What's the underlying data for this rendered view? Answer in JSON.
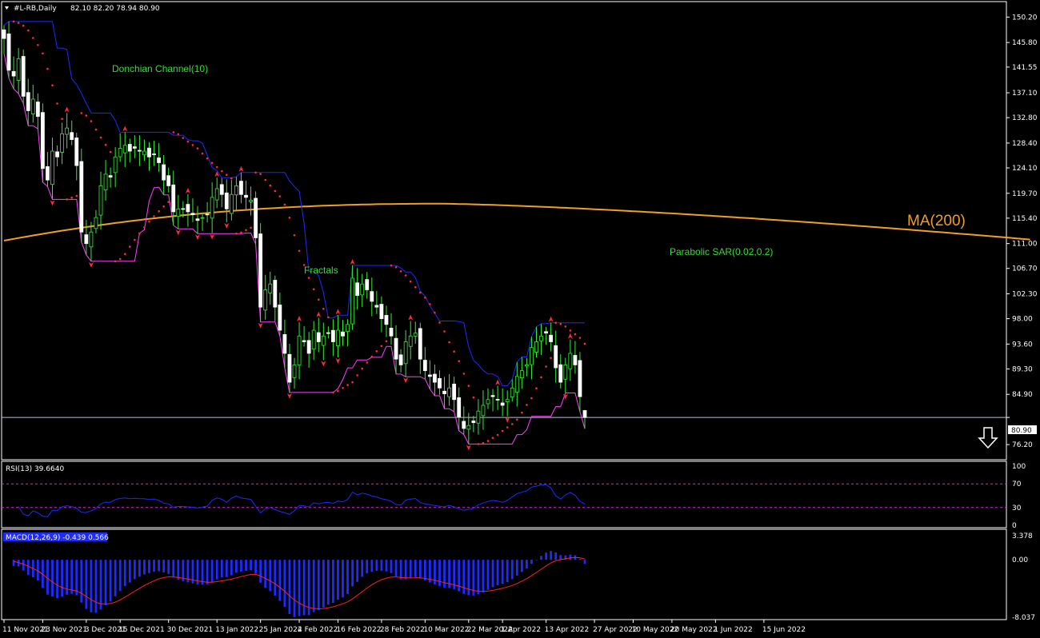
{
  "chart_data": [
    {
      "type": "candlestick",
      "title": "#L-RB,Daily",
      "ohlc_label": "82.10 82.20 78.94 80.90",
      "ylim": [
        74.0,
        151.5
      ],
      "y_ticks": [
        "150.20",
        "145.80",
        "141.55",
        "137.10",
        "132.80",
        "128.40",
        "124.10",
        "119.70",
        "115.40",
        "111.00",
        "106.70",
        "102.30",
        "98.00",
        "93.60",
        "89.30",
        "84.90",
        "80.90",
        "76.20"
      ],
      "x_labels": [
        "11 Nov 2021",
        "23 Nov 2021",
        "3 Dec 2021",
        "15 Dec 2021",
        "30 Dec 2021",
        "13 Jan 2022",
        "25 Jan 2022",
        "4 Feb 2022",
        "16 Feb 2022",
        "28 Feb 2022",
        "10 Mar 2022",
        "22 Mar 2022",
        "1 Apr 2022",
        "13 Apr 2022",
        "27 Apr 2022",
        "10 May 2022",
        "20 May 2022",
        "1 Jun 2022",
        "15 Jun 2022"
      ],
      "x_label_index": [
        0,
        8,
        17,
        24,
        34,
        44,
        53,
        61,
        69,
        78,
        87,
        96,
        103,
        112,
        122,
        130,
        138,
        147,
        157
      ],
      "current_price": 80.9,
      "close": [
        146.5,
        141,
        140,
        143,
        136.5,
        134,
        136,
        133,
        124,
        122,
        127,
        126,
        130,
        131,
        129,
        124.5,
        113,
        111,
        113,
        115.5,
        121,
        123,
        122.5,
        126,
        127.5,
        128,
        127,
        127.5,
        127,
        127,
        126,
        126.5,
        125,
        122,
        121,
        116.5,
        117,
        117,
        116.5,
        116,
        115,
        115.5,
        116,
        119,
        120.5,
        119.5,
        117,
        119.5,
        121,
        119.5,
        119,
        118.5,
        112,
        100,
        103,
        104,
        100,
        96,
        92,
        87,
        90,
        95,
        94,
        92,
        96,
        94,
        95,
        95.5,
        94,
        96,
        95,
        97,
        105,
        102,
        104,
        103,
        101,
        100,
        98,
        97,
        95,
        91,
        90,
        94,
        95,
        95.5,
        91,
        89,
        88,
        87,
        86,
        85,
        86,
        84,
        81,
        79,
        79.5,
        80,
        82,
        83,
        84,
        84.5,
        84,
        83,
        84,
        86,
        88,
        89,
        90,
        93,
        94,
        95,
        95.5,
        94,
        89.5,
        87,
        90,
        92,
        90,
        84.5,
        80.9
      ],
      "series": [
        {
          "name": "MA(200)",
          "color": "#f0a020",
          "start": [
            0,
            111.5
          ],
          "end": [
            212,
            111.7
          ],
          "peak": [
            90,
            117.9
          ]
        },
        {
          "name": "Donchian Channel(10)",
          "color": "#1e2aff"
        },
        {
          "name": "Donchian Channel(10)",
          "color": "#ff40ff"
        },
        {
          "name": "Parabolic SAR(0.02,0.2)",
          "color": "#ff2a3a"
        },
        {
          "name": "Fractals",
          "color": "#ff2a3a"
        }
      ],
      "annotations": [
        "Donchian Channel(10)",
        "Fractals",
        "Parabolic SAR(0.02,0.2)",
        "MA(200)"
      ],
      "arrow": "down",
      "grid": false
    },
    {
      "type": "line",
      "title": "RSI(13) 39.6640",
      "ylim": [
        0,
        100
      ],
      "y_ticks": [
        "100",
        "70",
        "30",
        "0"
      ],
      "levels": [
        70,
        30
      ],
      "color": "#1e2aff"
    },
    {
      "type": "bar",
      "title": "MACD(12,26,9) -0.439 0.566",
      "ylim": [
        -8.037,
        3.378
      ],
      "y_ticks": [
        "3.378",
        "0.00",
        "-8.037"
      ],
      "histogram_color": "#1e2aff",
      "signal_color": "#ff2020"
    }
  ],
  "labels": {
    "main_title": "#L-RB,Daily",
    "ohlc": "82.10 82.20 78.94 80.90",
    "rsi": "RSI(13) 39.6640",
    "macd": "MACD(12,26,9) -0.439 0.566",
    "donchian": "Donchian Channel(10)",
    "fractals": "Fractals",
    "psar": "Parabolic SAR(0.02,0.2)",
    "ma": "MA(200)",
    "price_tag": "80.90"
  }
}
